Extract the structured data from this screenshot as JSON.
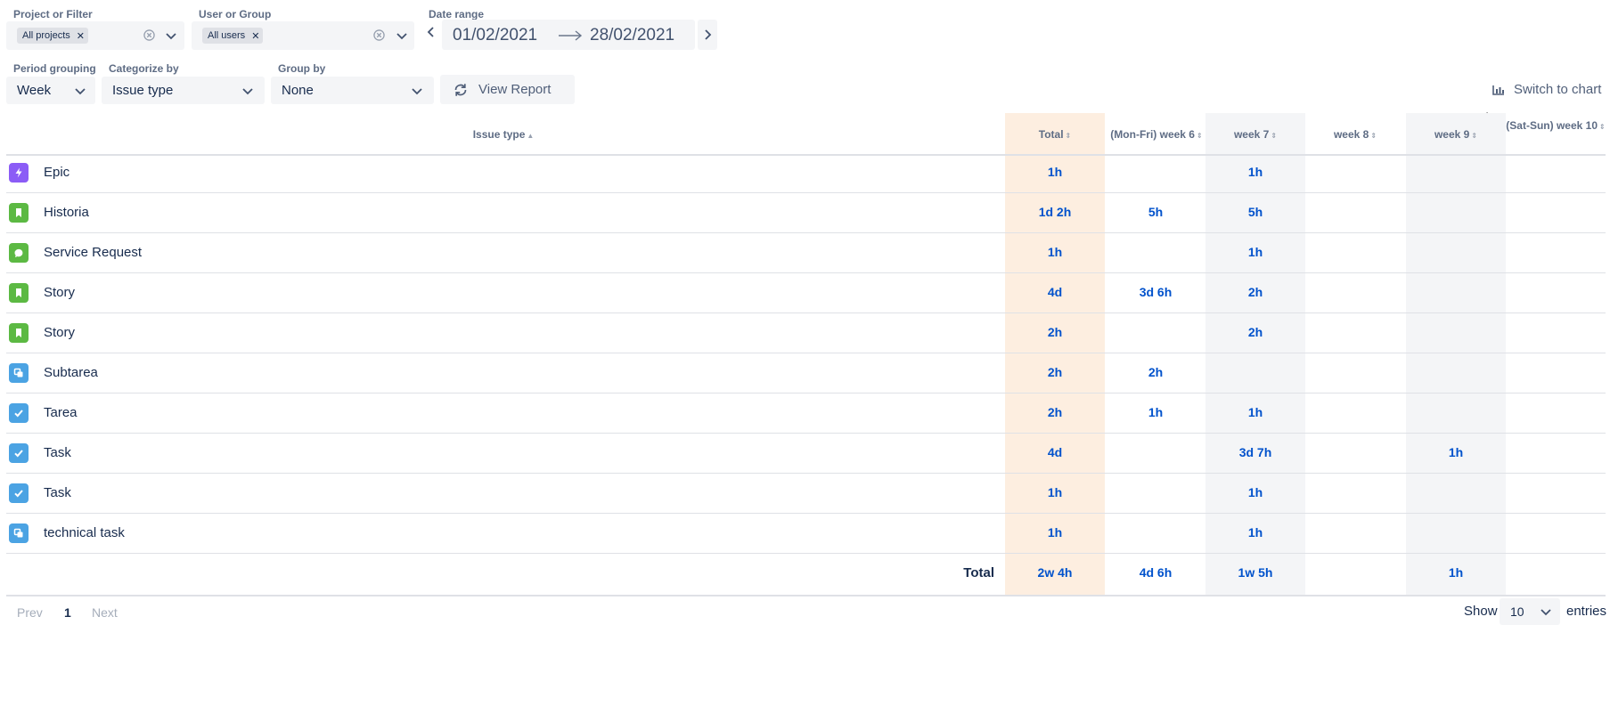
{
  "filters": {
    "project_label": "Project or Filter",
    "project_chip": "All projects",
    "user_label": "User or Group",
    "user_chip": "All users",
    "date_label": "Date range",
    "date_from": "01/02/2021",
    "date_to": "28/02/2021",
    "period_label": "Period grouping",
    "period_value": "Week",
    "categorize_label": "Categorize by",
    "categorize_value": "Issue type",
    "groupby_label": "Group by",
    "groupby_value": "None",
    "view_report": "View Report",
    "switch_chart": "Switch to chart"
  },
  "table": {
    "columns": [
      "Issue type",
      "Total",
      "(Mon-Fri) week 6",
      "week 7",
      "week 8",
      "week 9",
      "(Sat-Sun) week 10"
    ],
    "rows": [
      {
        "name": "Epic",
        "icon": "epic-icon",
        "color": "#8b5cf6",
        "cells": [
          "1h",
          "",
          "1h",
          "",
          "",
          ""
        ]
      },
      {
        "name": "Historia",
        "icon": "story-icon",
        "color": "#5cb943",
        "cells": [
          "1d 2h",
          "5h",
          "5h",
          "",
          "",
          ""
        ]
      },
      {
        "name": "Service Request",
        "icon": "service-request-icon",
        "color": "#5cb943",
        "cells": [
          "1h",
          "",
          "1h",
          "",
          "",
          ""
        ]
      },
      {
        "name": "Story",
        "icon": "story-icon",
        "color": "#5cb943",
        "cells": [
          "4d",
          "3d 6h",
          "2h",
          "",
          "",
          ""
        ]
      },
      {
        "name": "Story",
        "icon": "story-icon",
        "color": "#5cb943",
        "cells": [
          "2h",
          "",
          "2h",
          "",
          "",
          ""
        ]
      },
      {
        "name": "Subtarea",
        "icon": "subtask-icon",
        "color": "#4ba3e3",
        "cells": [
          "2h",
          "2h",
          "",
          "",
          "",
          ""
        ]
      },
      {
        "name": "Tarea",
        "icon": "task-icon",
        "color": "#4ba3e3",
        "cells": [
          "2h",
          "1h",
          "1h",
          "",
          "",
          ""
        ]
      },
      {
        "name": "Task",
        "icon": "task-icon",
        "color": "#4ba3e3",
        "cells": [
          "4d",
          "",
          "3d 7h",
          "",
          "1h",
          ""
        ]
      },
      {
        "name": "Task",
        "icon": "task-icon",
        "color": "#4ba3e3",
        "cells": [
          "1h",
          "",
          "1h",
          "",
          "",
          ""
        ]
      },
      {
        "name": "technical task",
        "icon": "subtask-icon",
        "color": "#4ba3e3",
        "cells": [
          "1h",
          "",
          "1h",
          "",
          "",
          ""
        ]
      }
    ],
    "total_label": "Total",
    "totals": [
      "2w 4h",
      "4d 6h",
      "1w 5h",
      "",
      "1h",
      ""
    ]
  },
  "pagination": {
    "prev": "Prev",
    "page": "1",
    "next": "Next",
    "show_label": "Show",
    "entries_value": "10",
    "entries_label": "entries"
  }
}
